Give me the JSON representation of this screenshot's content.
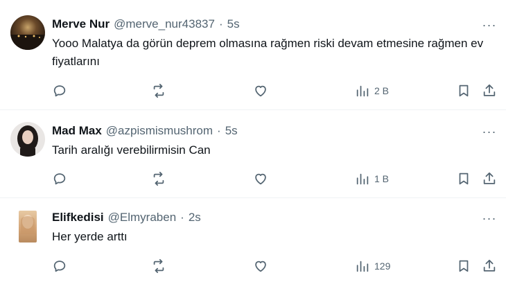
{
  "tweets": [
    {
      "name": "Merve Nur",
      "handle": "@merve_nur43837",
      "dot": "·",
      "time": "5s",
      "text": "Yooo Malatya da görün deprem olmasına rağmen riski devam etmesine rağmen ev fiyatlarını",
      "views": "2 B",
      "more": "···",
      "avatar_color": "#3a2a1c"
    },
    {
      "name": "Mad Max",
      "handle": "@azpismismushrom",
      "dot": "·",
      "time": "5s",
      "text": "Tarih aralığı verebilirmisin Can",
      "views": "1 B",
      "more": "···",
      "avatar_color": "#2a2320"
    },
    {
      "name": "Elifkedisi",
      "handle": "@Elmyraben",
      "dot": "·",
      "time": "2s",
      "text": "Her yerde arttı",
      "views": "129",
      "more": "···",
      "avatar_color": "#d9b48a"
    }
  ],
  "colors": {
    "text_primary": "#0f1419",
    "text_secondary": "#536471",
    "divider": "#eff3f4"
  },
  "icons": [
    "reply-icon",
    "retweet-icon",
    "like-icon",
    "views-icon",
    "bookmark-icon",
    "share-icon",
    "more-icon"
  ]
}
